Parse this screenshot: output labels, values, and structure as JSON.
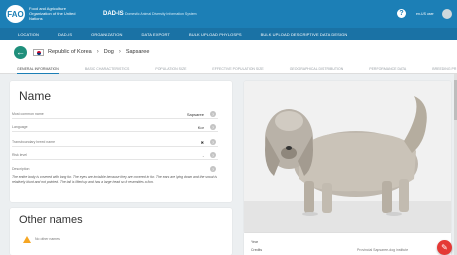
{
  "header": {
    "logo_text": "FAO",
    "org_name": "Food and Agriculture Organization of the United Nations",
    "app_title": "DAD-IS",
    "app_subtitle": "Domestic Animal Diversity Information System",
    "user_label": "en-US user",
    "color": "#1c7fb6"
  },
  "menu": {
    "items": [
      "LOCATION",
      "DAD-IS",
      "ORGANIZATION",
      "DATA EXPORT",
      "BULK UPLOAD PHYLOSPS",
      "BULK UPLOAD DESCRIPTIVE DATA DESIGN"
    ]
  },
  "breadcrumb": {
    "country": "Republic of Korea",
    "species": "Dog",
    "breed": "Sapsaree",
    "back_color": "#1f8f7b"
  },
  "tabs": [
    "GENERAL INFORMATION",
    "BASIC CHARACTERISTICS",
    "POPULATION SIZE",
    "EFFECTIVE POPULATION SIZE",
    "GEOGRAPHICAL DISTRIBUTION",
    "PERFORMANCE DATA",
    "BREEDING PR"
  ],
  "name_card": {
    "title": "Name",
    "fields": [
      {
        "label": "Most common name",
        "value": "Sapsaree"
      },
      {
        "label": "Language",
        "value": "Kor"
      },
      {
        "label": "Transboundary breed name",
        "value": "✖"
      },
      {
        "label": "Risk level",
        "value": "-"
      },
      {
        "label": "Description",
        "value": ""
      }
    ],
    "description": "The entire body is covered with long fur. The eyes are invisible because they are covered in fur. The ears are lying down and the snout is relatively blunt and not pointed. The tail is lifted up and has a large head so it resembles a lion."
  },
  "other_names": {
    "title": "Other names",
    "empty_text": "No other names"
  },
  "photo": {
    "year_label": "Year",
    "credits_label": "Credits",
    "credits_value": "Provincial Sapsaree-dog institute"
  },
  "fab_label": "✎"
}
